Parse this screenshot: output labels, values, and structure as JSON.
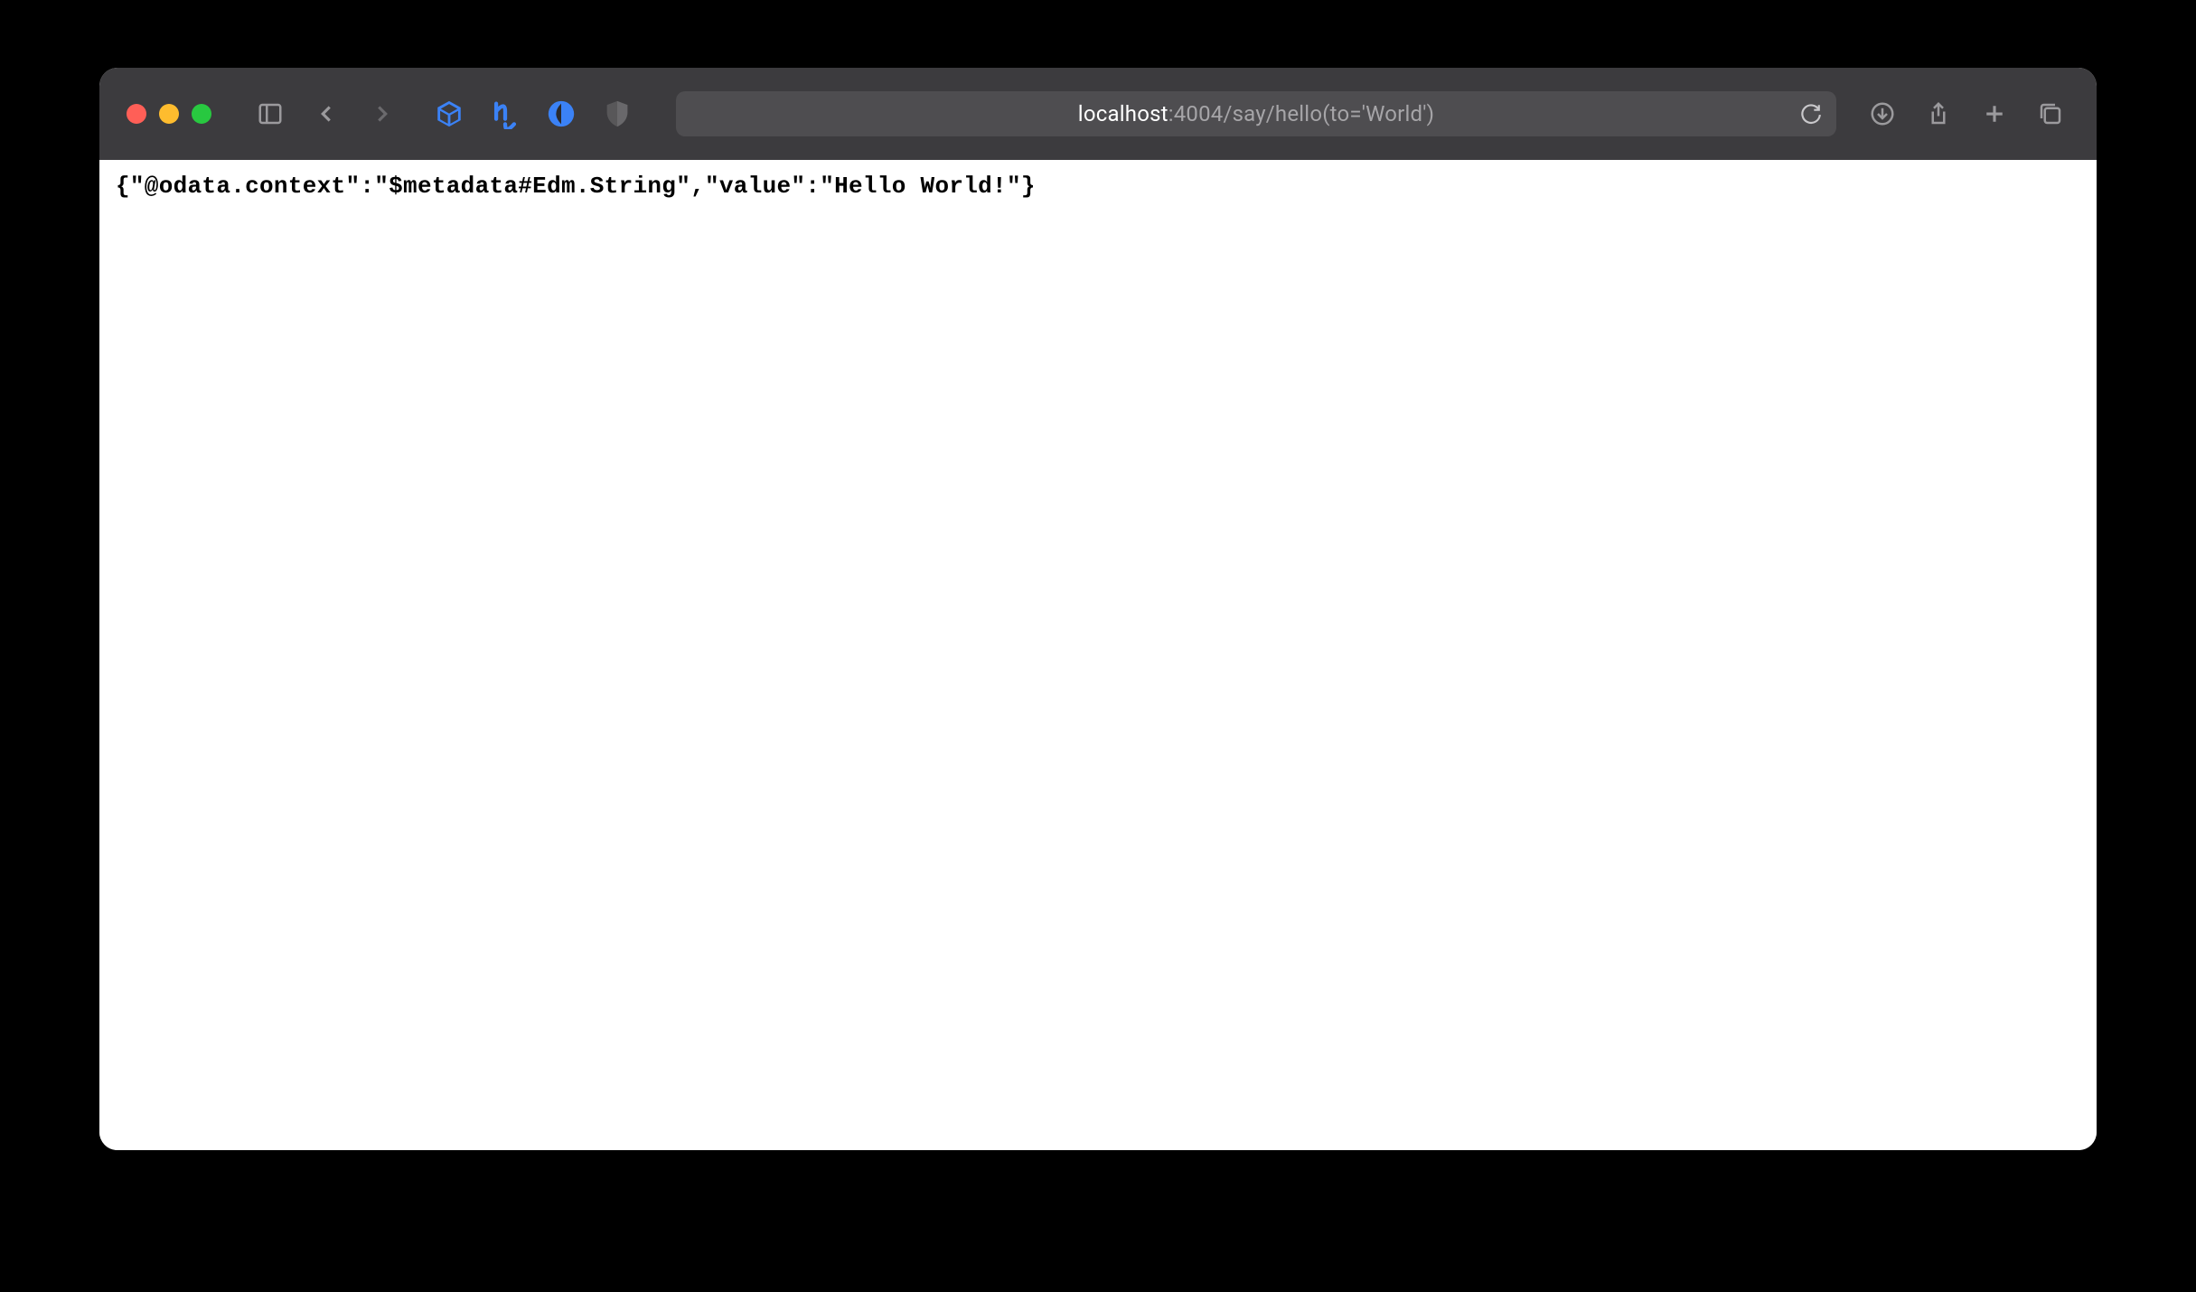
{
  "toolbar": {
    "address": {
      "host": "localhost",
      "port": ":4004",
      "path": "/say/hello(to='World')"
    }
  },
  "page": {
    "body": "{\"@odata.context\":\"$metadata#Edm.String\",\"value\":\"Hello World!\"}"
  }
}
